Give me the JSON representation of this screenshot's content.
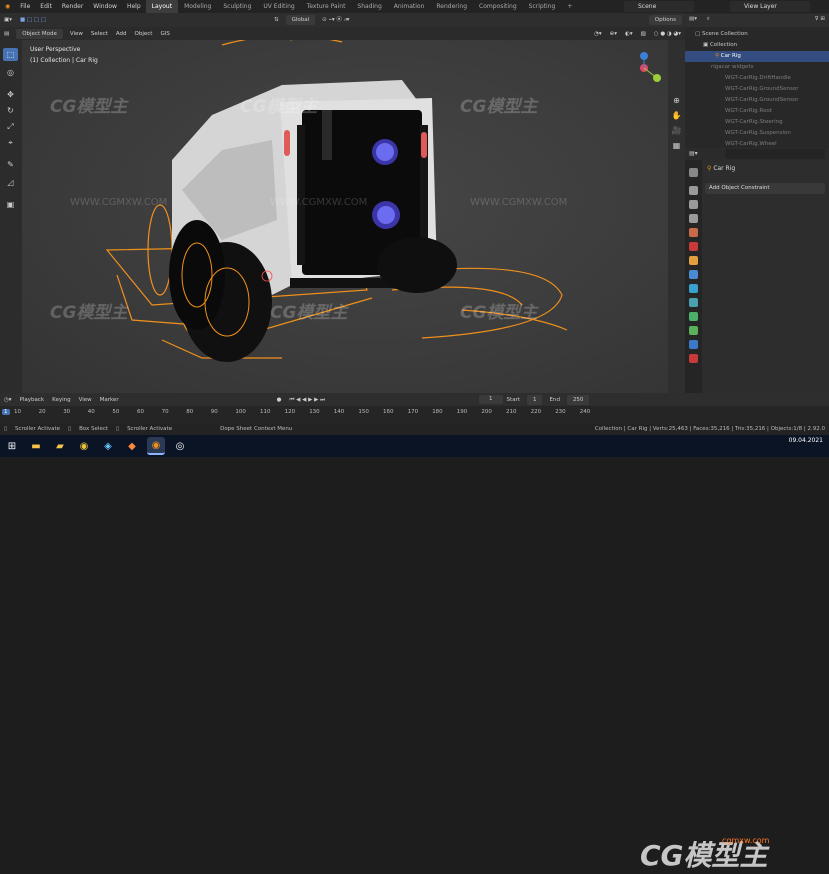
{
  "menus": [
    "File",
    "Edit",
    "Render",
    "Window",
    "Help"
  ],
  "workspaces": [
    "Layout",
    "Modeling",
    "Sculpting",
    "UV Editing",
    "Texture Paint",
    "Shading",
    "Animation",
    "Rendering",
    "Compositing",
    "Scripting"
  ],
  "scene": {
    "label": "Scene"
  },
  "view_layer": {
    "label": "View Layer"
  },
  "header": {
    "mode": "Object Mode",
    "view": "View",
    "select": "Select",
    "add": "Add",
    "object": "Object",
    "gis": "GIS",
    "orientation": "Global",
    "options": "Options"
  },
  "viewport": {
    "title": "User Perspective",
    "subtitle": "(1) Collection | Car Rig"
  },
  "watermark": {
    "logo": "CG模型主",
    "site": "WWW.CGMXW.COM",
    "site2": "cgmxw.com"
  },
  "outliner": {
    "rows": [
      {
        "label": "Scene Collection",
        "state": "normal"
      },
      {
        "label": "Collection",
        "state": "normal"
      },
      {
        "label": "Car Rig",
        "state": "selected"
      },
      {
        "label": "rigacar widgets",
        "state": "dim"
      },
      {
        "label": "WGT-CarRig.DriftHandle",
        "state": "dim"
      },
      {
        "label": "WGT-CarRig.GroundSensor",
        "state": "dim"
      },
      {
        "label": "WGT-CarRig.GroundSensor",
        "state": "dim"
      },
      {
        "label": "WGT-CarRig.Root",
        "state": "dim"
      },
      {
        "label": "WGT-CarRig.Steering",
        "state": "dim"
      },
      {
        "label": "WGT-CarRig.Suspension",
        "state": "dim"
      },
      {
        "label": "WGT-CarRig.Wheel",
        "state": "dim"
      }
    ]
  },
  "properties": {
    "object_name": "Car Rig",
    "add_constraint": "Add Object Constraint"
  },
  "timeline": {
    "playback": "Playback",
    "keying": "Keying",
    "view": "View",
    "marker": "Marker",
    "current_frame": "1",
    "start_label": "Start",
    "start_value": "1",
    "end_label": "End",
    "end_value": "250",
    "ticks": [
      "10",
      "20",
      "30",
      "40",
      "50",
      "60",
      "70",
      "80",
      "90",
      "100",
      "110",
      "120",
      "130",
      "140",
      "150",
      "160",
      "170",
      "180",
      "190",
      "200",
      "210",
      "220",
      "230",
      "240"
    ]
  },
  "status": {
    "scroller1": "Scroller Activate",
    "box_select": "Box Select",
    "scroller2": "Scroller Activate",
    "context": "Dope Sheet Context Menu",
    "stats": "Collection | Car Rig | Verts:25,463 | Faces:35,216 | Tris:35,216 | Objects:1/8 | 2.92.0"
  },
  "clock": {
    "date": "09.04.2021"
  },
  "colors": {
    "accent": "#4772b3",
    "rig_orange": "#f0901c",
    "selected_row": "#334d80"
  }
}
